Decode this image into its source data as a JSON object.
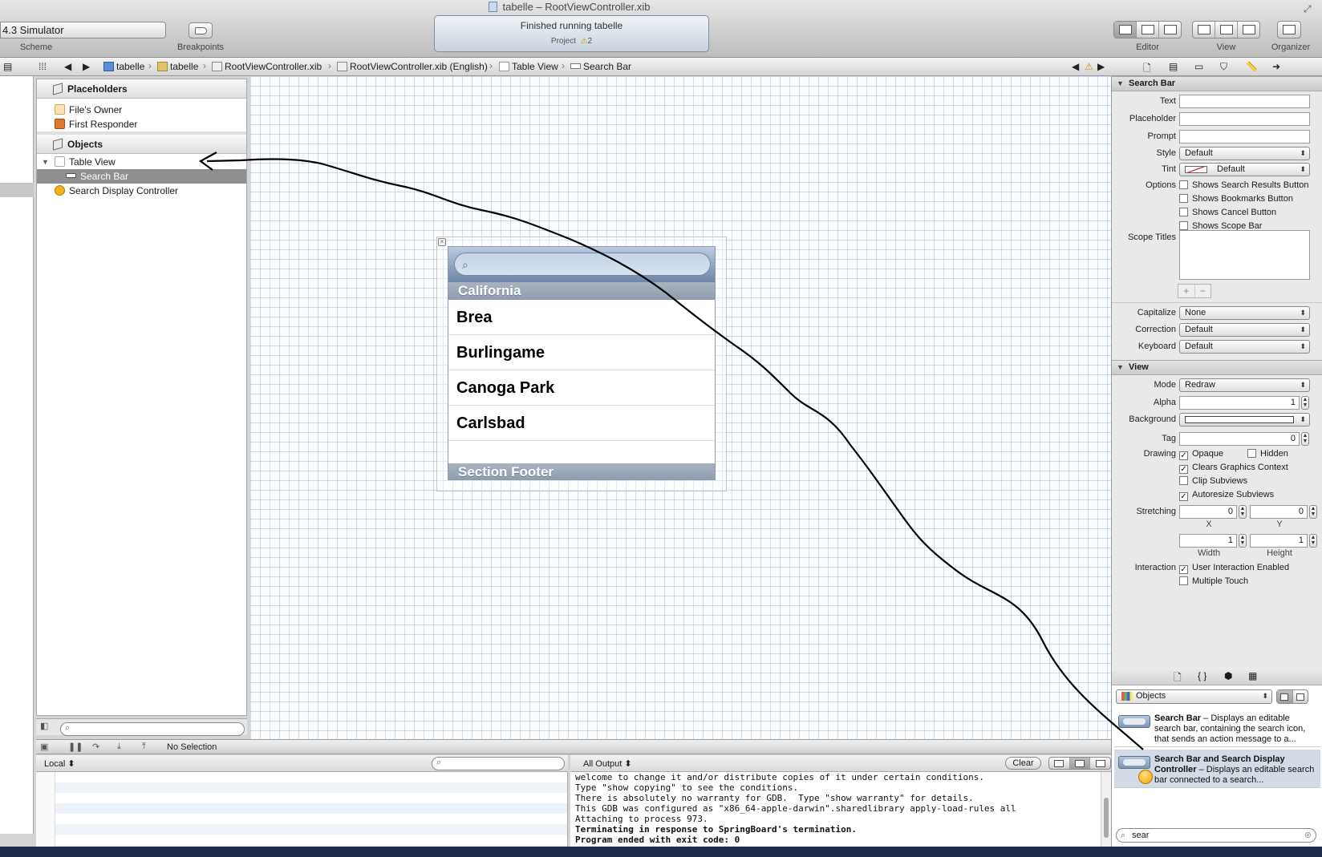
{
  "window": {
    "title": "tabelle – RootViewController.xib"
  },
  "toolbar": {
    "scheme": "4.3 Simulator",
    "scheme_caption": "Scheme",
    "breakpoints_caption": "Breakpoints",
    "activity_status": "Finished running tabelle",
    "activity_project": "Project",
    "activity_warnings": "2",
    "editor_caption": "Editor",
    "view_caption": "View",
    "organizer_caption": "Organizer"
  },
  "jumpbar": {
    "items": [
      "tabelle",
      "tabelle",
      "RootViewController.xib",
      "RootViewController.xib (English)",
      "Table View",
      "Search Bar"
    ]
  },
  "outline": {
    "placeholders_header": "Placeholders",
    "placeholders": [
      "File's Owner",
      "First Responder"
    ],
    "objects_header": "Objects",
    "objects": [
      "Table View",
      "Search Bar",
      "Search Display Controller"
    ],
    "selected": "Search Bar"
  },
  "canvas": {
    "section_header": "California",
    "cells": [
      "Brea",
      "Burlingame",
      "Canoga Park",
      "Carlsbad"
    ],
    "section_footer": "Section Footer"
  },
  "debugbar": {
    "status": "No Selection"
  },
  "variables": {
    "scope": "Local"
  },
  "console": {
    "scope": "All Output",
    "clear_label": "Clear",
    "lines": [
      "welcome to change it and/or distribute copies of it under certain conditions.",
      "Type \"show copying\" to see the conditions.",
      "There is absolutely no warranty for GDB.  Type \"show warranty\" for details.",
      "This GDB was configured as \"x86_64-apple-darwin\".sharedlibrary apply-load-rules all",
      "Attaching to process 973.",
      "Terminating in response to SpringBoard's termination.",
      "Program ended with exit code: 0"
    ],
    "bold_from": 5
  },
  "inspector": {
    "search_bar_section": "Search Bar",
    "text_label": "Text",
    "placeholder_label": "Placeholder",
    "prompt_label": "Prompt",
    "style_label": "Style",
    "style_value": "Default",
    "tint_label": "Tint",
    "tint_value": "Default",
    "options_label": "Options",
    "options": [
      {
        "label": "Shows Search Results Button",
        "checked": false
      },
      {
        "label": "Shows Bookmarks Button",
        "checked": false
      },
      {
        "label": "Shows Cancel Button",
        "checked": false
      },
      {
        "label": "Shows Scope Bar",
        "checked": false
      }
    ],
    "scope_titles_label": "Scope Titles",
    "capitalize_label": "Capitalize",
    "capitalize_value": "None",
    "correction_label": "Correction",
    "correction_value": "Default",
    "keyboard_label": "Keyboard",
    "keyboard_value": "Default",
    "view_section": "View",
    "mode_label": "Mode",
    "mode_value": "Redraw",
    "alpha_label": "Alpha",
    "alpha_value": "1",
    "background_label": "Background",
    "tag_label": "Tag",
    "tag_value": "0",
    "drawing_label": "Drawing",
    "drawing": [
      {
        "label": "Opaque",
        "checked": true
      },
      {
        "label": "Hidden",
        "checked": false
      },
      {
        "label": "Clears Graphics Context",
        "checked": true
      },
      {
        "label": "Clip Subviews",
        "checked": false
      },
      {
        "label": "Autoresize Subviews",
        "checked": true
      }
    ],
    "stretching_label": "Stretching",
    "stretch_x": "0",
    "stretch_y": "0",
    "stretch_w": "1",
    "stretch_h": "1",
    "x_caption": "X",
    "y_caption": "Y",
    "width_caption": "Width",
    "height_caption": "Height",
    "interaction_label": "Interaction",
    "interaction": [
      {
        "label": "User Interaction Enabled",
        "checked": true
      },
      {
        "label": "Multiple Touch",
        "checked": false
      }
    ]
  },
  "library": {
    "popup_value": "Objects",
    "items": [
      {
        "title": "Search Bar",
        "desc": " – Displays an editable search bar, containing the search icon, that sends an action message to a..."
      },
      {
        "title": "Search Bar and Search Display Controller",
        "desc": " – Displays an editable search bar connected to a search..."
      }
    ],
    "filter_value": "sear"
  },
  "colors": {
    "selection": "#8f8f8f",
    "search_bar": "#6d85a8",
    "section_header": "#98a6b5"
  }
}
